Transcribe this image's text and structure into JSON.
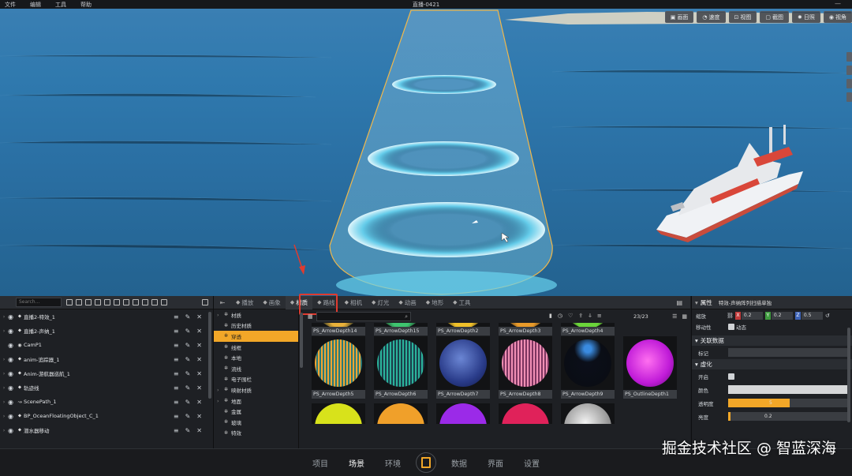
{
  "menubar": {
    "items": [
      "文件",
      "编辑",
      "工具",
      "帮助"
    ],
    "title": "直播-0421"
  },
  "viewport_toolbar": [
    {
      "label": "画面",
      "icon": "picture-icon"
    },
    {
      "label": "速度",
      "icon": "speed-icon"
    },
    {
      "label": "视图",
      "icon": "view-icon"
    },
    {
      "label": "截图",
      "icon": "screenshot-icon"
    },
    {
      "label": "日照",
      "icon": "sun-icon"
    },
    {
      "label": "视角",
      "icon": "eye-icon"
    }
  ],
  "outliner": {
    "search_placeholder": "Search...",
    "items": [
      {
        "label": "直播2-特效_1",
        "icon": "pin-icon"
      },
      {
        "label": "直播2-声纳_1",
        "icon": "pin-icon"
      },
      {
        "label": "CamP1",
        "icon": "camera-icon"
      },
      {
        "label": "anim-追踪器_1",
        "icon": "pin-icon"
      },
      {
        "label": "Anim-游航器巡航_1",
        "icon": "pin-icon"
      },
      {
        "label": "轨迹线",
        "icon": "pin-icon"
      },
      {
        "label": "ScenePath_1",
        "icon": "path-icon"
      },
      {
        "label": "BP_OceanFloatingObject_C_1",
        "icon": "pin-icon"
      },
      {
        "label": "潜水器移动",
        "icon": "pin-icon"
      }
    ]
  },
  "tabs": [
    {
      "label": "播放",
      "icon": "play-icon"
    },
    {
      "label": "画象",
      "icon": "image-icon"
    },
    {
      "label": "材质",
      "icon": "material-icon",
      "active": true
    },
    {
      "label": "路线",
      "icon": "route-icon"
    },
    {
      "label": "相机",
      "icon": "camera-icon"
    },
    {
      "label": "灯光",
      "icon": "light-icon"
    },
    {
      "label": "动画",
      "icon": "animation-icon"
    },
    {
      "label": "地形",
      "icon": "terrain-icon"
    },
    {
      "label": "工具",
      "icon": "tool-icon"
    }
  ],
  "material_tree": [
    {
      "label": "材质",
      "expand": true
    },
    {
      "label": "历史材质",
      "expand": false
    },
    {
      "label": "穿透",
      "expand": false,
      "selected": true
    },
    {
      "label": "线框",
      "expand": false
    },
    {
      "label": "本地",
      "expand": false
    },
    {
      "label": "流线",
      "expand": false
    },
    {
      "label": "电子围栏",
      "expand": false
    },
    {
      "label": "映射材质",
      "expand": true
    },
    {
      "label": "地面",
      "expand": true
    },
    {
      "label": "金属",
      "expand": false
    },
    {
      "label": "玻璃",
      "expand": false
    },
    {
      "label": "特效",
      "expand": false
    }
  ],
  "assets": {
    "count": "23/23",
    "row0": [
      "PS_ArrowDepth14",
      "PS_ArrowDepth15",
      "PS_ArrowDepth2",
      "PS_ArrowDepth3",
      "PS_ArrowDepth4"
    ],
    "row1": [
      "PS_ArrowDepth5",
      "PS_ArrowDepth6",
      "PS_ArrowDepth7",
      "PS_ArrowDepth8",
      "PS_ArrowDepth9",
      "PS_OutlineDepth1"
    ]
  },
  "properties": {
    "header": "属性",
    "object_name": "特效-声纳阵列扫描单独",
    "scale_label": "缩放",
    "scale": {
      "x": "0.2",
      "y": "0.2",
      "z": "0.5"
    },
    "movable_label": "移动性",
    "movable_value": "动态",
    "section_link": "关联数据",
    "tag_label": "标记",
    "section_virtual": "虚化",
    "enable_label": "开启",
    "color_label": "颜色",
    "opacity_label": "透明度",
    "opacity_value": "5",
    "brightness_label": "亮度",
    "brightness_value": "0.2",
    "opacity_fill": 0.5,
    "brightness_fill": 0.02
  },
  "bottom_nav": [
    "项目",
    "场景",
    "环境",
    "数据",
    "界面",
    "设置"
  ],
  "bottom_nav_active": "场景",
  "watermark": "掘金技术社区 @ 智蓝深海",
  "colors": {
    "accent": "#f2a728",
    "highlight_box": "#e03b2f"
  }
}
